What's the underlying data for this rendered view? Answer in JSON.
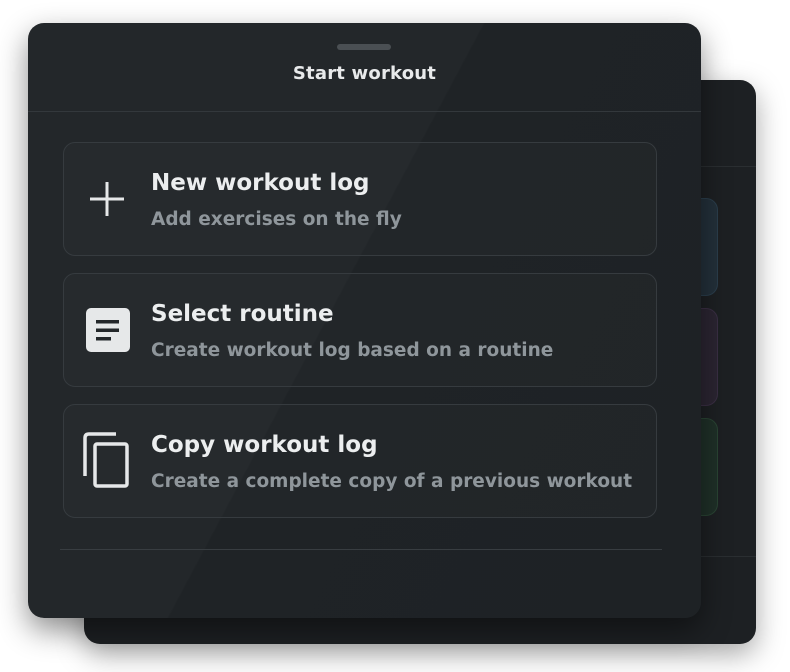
{
  "sheet": {
    "title": "Start workout"
  },
  "options": [
    {
      "title": "New workout log",
      "subtitle": "Add exercises on the fly",
      "icon": "plus-icon"
    },
    {
      "title": "Select routine",
      "subtitle": "Create workout log based on a routine",
      "icon": "document-icon"
    },
    {
      "title": "Copy workout log",
      "subtitle": "Create a complete copy of a previous workout",
      "icon": "copy-icon"
    }
  ],
  "colors": {
    "sheet_bg": "#23272a",
    "text_primary": "#eceeef",
    "text_secondary": "#8f969b",
    "border": "#363b3f"
  }
}
